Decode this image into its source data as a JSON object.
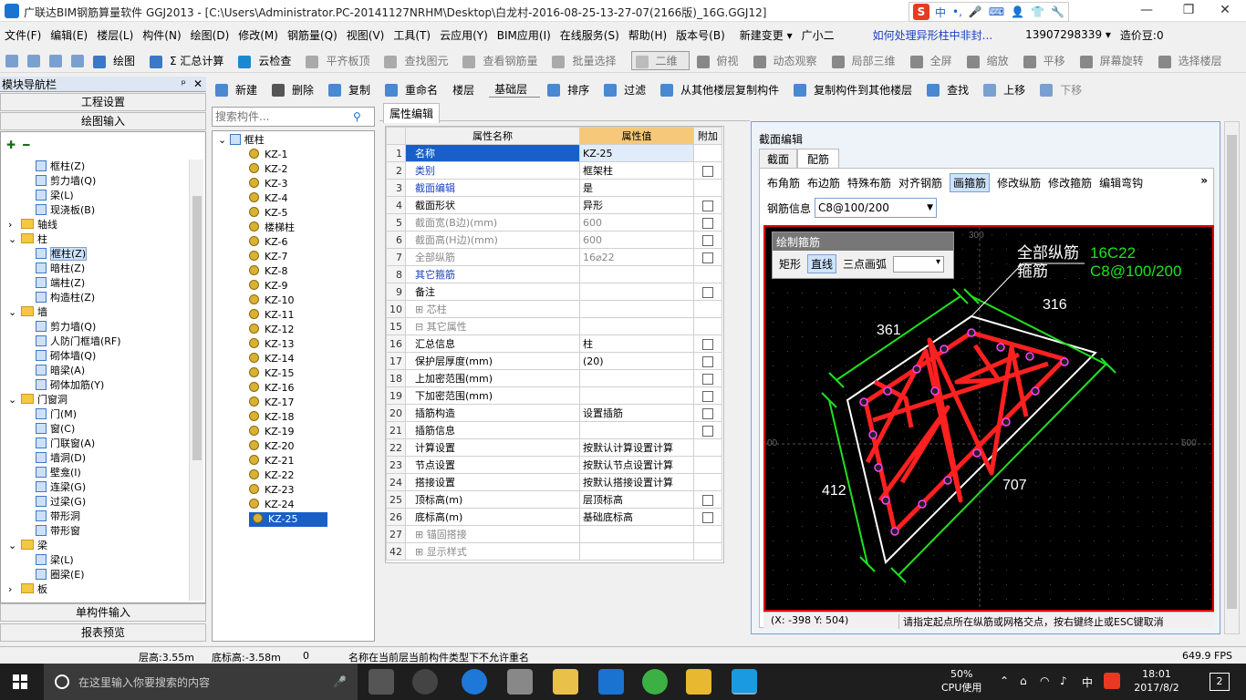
{
  "window": {
    "title": "广联达BIM钢筋算量软件 GGJ2013 - [C:\\Users\\Administrator.PC-20141127NRHM\\Desktop\\白龙村-2016-08-25-13-27-07(2166版)_16G.GGJ12]",
    "min": "—",
    "max": "❐",
    "close": "✕"
  },
  "ime": {
    "logo": "S",
    "items": [
      "中",
      "•,",
      "🎤",
      "⌨",
      "👤",
      "👕",
      "🔧"
    ]
  },
  "menu": [
    "文件(F)",
    "编辑(E)",
    "楼层(L)",
    "构件(N)",
    "绘图(D)",
    "修改(M)",
    "钢筋量(Q)",
    "视图(V)",
    "工具(T)",
    "云应用(Y)",
    "BIM应用(I)",
    "在线服务(S)",
    "帮助(H)",
    "版本号(B)",
    "新建变更 ▾",
    "广小二",
    "如何处理异形柱中非封...",
    "13907298339 ▾",
    "造价豆:0"
  ],
  "toolbar1": [
    "绘图",
    "Σ 汇总计算",
    "云检查",
    "平齐板顶",
    "查找图元",
    "查看钢筋量",
    "批量选择",
    "二维",
    "俯视",
    "动态观察",
    "局部三维",
    "全屏",
    "缩放",
    "平移",
    "屏幕旋转",
    "选择楼层"
  ],
  "toolbar2": [
    "新建",
    "删除",
    "复制",
    "重命名",
    "楼层",
    "基础层",
    "排序",
    "过滤",
    "从其他楼层复制构件",
    "复制构件到其他楼层",
    "查找",
    "上移",
    "下移"
  ],
  "nav": {
    "header": "模块导航栏",
    "pin": "ᵖ",
    "close": "✕",
    "btn_project": "工程设置",
    "btn_draw": "绘图输入",
    "btn_single": "单构件输入",
    "btn_report": "报表预览",
    "items": [
      {
        "indent": 2,
        "type": "icon",
        "label": "框柱(Z)"
      },
      {
        "indent": 2,
        "type": "icon",
        "label": "剪力墙(Q)"
      },
      {
        "indent": 2,
        "type": "icon",
        "label": "梁(L)"
      },
      {
        "indent": 2,
        "type": "icon",
        "label": "现浇板(B)"
      },
      {
        "indent": 0,
        "type": "folder",
        "exp": "›",
        "label": "轴线"
      },
      {
        "indent": 0,
        "type": "folder",
        "exp": "⌄",
        "label": "柱"
      },
      {
        "indent": 2,
        "type": "icon",
        "label": "框柱(Z)",
        "sel": true
      },
      {
        "indent": 2,
        "type": "icon",
        "label": "暗柱(Z)"
      },
      {
        "indent": 2,
        "type": "icon",
        "label": "端柱(Z)"
      },
      {
        "indent": 2,
        "type": "icon",
        "label": "构造柱(Z)"
      },
      {
        "indent": 0,
        "type": "folder",
        "exp": "⌄",
        "label": "墙"
      },
      {
        "indent": 2,
        "type": "icon",
        "label": "剪力墙(Q)"
      },
      {
        "indent": 2,
        "type": "icon",
        "label": "人防门框墙(RF)"
      },
      {
        "indent": 2,
        "type": "icon",
        "label": "砌体墙(Q)"
      },
      {
        "indent": 2,
        "type": "icon",
        "label": "暗梁(A)"
      },
      {
        "indent": 2,
        "type": "icon",
        "label": "砌体加筋(Y)"
      },
      {
        "indent": 0,
        "type": "folder",
        "exp": "⌄",
        "label": "门窗洞"
      },
      {
        "indent": 2,
        "type": "icon",
        "label": "门(M)"
      },
      {
        "indent": 2,
        "type": "icon",
        "label": "窗(C)"
      },
      {
        "indent": 2,
        "type": "icon",
        "label": "门联窗(A)"
      },
      {
        "indent": 2,
        "type": "icon",
        "label": "墙洞(D)"
      },
      {
        "indent": 2,
        "type": "icon",
        "label": "壁龛(I)"
      },
      {
        "indent": 2,
        "type": "icon",
        "label": "连梁(G)"
      },
      {
        "indent": 2,
        "type": "icon",
        "label": "过梁(G)"
      },
      {
        "indent": 2,
        "type": "icon",
        "label": "带形洞"
      },
      {
        "indent": 2,
        "type": "icon",
        "label": "带形窗"
      },
      {
        "indent": 0,
        "type": "folder",
        "exp": "⌄",
        "label": "梁"
      },
      {
        "indent": 2,
        "type": "icon",
        "label": "梁(L)"
      },
      {
        "indent": 2,
        "type": "icon",
        "label": "圈梁(E)"
      },
      {
        "indent": 0,
        "type": "folder",
        "exp": "›",
        "label": "板"
      }
    ]
  },
  "comp": {
    "search_placeholder": "搜索构件...",
    "root": "框柱",
    "items": [
      "KZ-1",
      "KZ-2",
      "KZ-3",
      "KZ-4",
      "KZ-5",
      "楼梯柱",
      "KZ-6",
      "KZ-7",
      "KZ-8",
      "KZ-9",
      "KZ-10",
      "KZ-11",
      "KZ-12",
      "KZ-13",
      "KZ-14",
      "KZ-15",
      "KZ-16",
      "KZ-17",
      "KZ-18",
      "KZ-19",
      "KZ-20",
      "KZ-21",
      "KZ-22",
      "KZ-23",
      "KZ-24",
      "KZ-25"
    ]
  },
  "props": {
    "tab": "属性编辑",
    "h_name": "属性名称",
    "h_value": "属性值",
    "h_extra": "附加",
    "rows": [
      {
        "n": "1",
        "k": "名称",
        "v": "KZ-25",
        "cb": false,
        "c": "b",
        "sel": true
      },
      {
        "n": "2",
        "k": "类别",
        "v": "框架柱",
        "cb": true,
        "c": "b"
      },
      {
        "n": "3",
        "k": "截面编辑",
        "v": "是",
        "cb": false,
        "c": "b"
      },
      {
        "n": "4",
        "k": "截面形状",
        "v": "异形",
        "cb": true,
        "c": ""
      },
      {
        "n": "5",
        "k": "截面宽(B边)(mm)",
        "v": "600",
        "cb": true,
        "c": "g"
      },
      {
        "n": "6",
        "k": "截面高(H边)(mm)",
        "v": "600",
        "cb": true,
        "c": "g"
      },
      {
        "n": "7",
        "k": "全部纵筋",
        "v": "16⌀22",
        "cb": true,
        "c": "g"
      },
      {
        "n": "8",
        "k": "其它箍筋",
        "v": "",
        "cb": false,
        "c": "b"
      },
      {
        "n": "9",
        "k": "备注",
        "v": "",
        "cb": true,
        "c": ""
      },
      {
        "n": "10",
        "k": "⊞ 芯柱",
        "v": "",
        "cb": false,
        "c": "g"
      },
      {
        "n": "15",
        "k": "⊟ 其它属性",
        "v": "",
        "cb": false,
        "c": "g"
      },
      {
        "n": "16",
        "k": "    汇总信息",
        "v": "柱",
        "cb": true,
        "c": ""
      },
      {
        "n": "17",
        "k": "    保护层厚度(mm)",
        "v": "(20)",
        "cb": true,
        "c": ""
      },
      {
        "n": "18",
        "k": "    上加密范围(mm)",
        "v": "",
        "cb": true,
        "c": ""
      },
      {
        "n": "19",
        "k": "    下加密范围(mm)",
        "v": "",
        "cb": true,
        "c": ""
      },
      {
        "n": "20",
        "k": "    插筋构造",
        "v": "设置插筋",
        "cb": true,
        "c": ""
      },
      {
        "n": "21",
        "k": "    插筋信息",
        "v": "",
        "cb": true,
        "c": ""
      },
      {
        "n": "22",
        "k": "    计算设置",
        "v": "按默认计算设置计算",
        "cb": false,
        "c": ""
      },
      {
        "n": "23",
        "k": "    节点设置",
        "v": "按默认节点设置计算",
        "cb": false,
        "c": ""
      },
      {
        "n": "24",
        "k": "    搭接设置",
        "v": "按默认搭接设置计算",
        "cb": false,
        "c": ""
      },
      {
        "n": "25",
        "k": "    顶标高(m)",
        "v": "层顶标高",
        "cb": true,
        "c": ""
      },
      {
        "n": "26",
        "k": "    底标高(m)",
        "v": "基础底标高",
        "cb": true,
        "c": ""
      },
      {
        "n": "27",
        "k": "⊞ 锚固搭接",
        "v": "",
        "cb": false,
        "c": "g"
      },
      {
        "n": "42",
        "k": "⊞ 显示样式",
        "v": "",
        "cb": false,
        "c": "g"
      }
    ]
  },
  "section": {
    "title": "截面编辑",
    "tab1": "截面",
    "tab2": "配筋",
    "tools": [
      "布角筋",
      "布边筋",
      "特殊布筋",
      "对齐钢筋",
      "画箍筋",
      "修改纵筋",
      "修改箍筋",
      "编辑弯钩"
    ],
    "info_label": "钢筋信息",
    "info_value": "C8@100/200",
    "stirrup_title": "绘制箍筋",
    "stirrup_btns": [
      "矩形",
      "直线",
      "三点画弧"
    ],
    "label_long": "全部纵筋",
    "label_stir": "箍筋",
    "val_long": "16C22",
    "val_stir": "C8@100/200",
    "dims": [
      "361",
      "316",
      "412",
      "707"
    ],
    "grid_lbl": [
      "300",
      "00",
      "500"
    ],
    "coords": "(X: -398 Y: 504)",
    "hint": "请指定起点所在纵筋或网格交点，按右键终止或ESC键取消"
  },
  "status": {
    "floor_h": "层高:3.55m",
    "base_h": "底标高:-3.58m",
    "zero": "0",
    "msg": "名称在当前层当前构件类型下不允许重名",
    "fps": "649.9 FPS"
  },
  "taskbar": {
    "search": "在这里输入你要搜索的内容",
    "cpu": "50%",
    "cpu_lbl": "CPU使用",
    "time": "18:01",
    "date": "2017/8/2",
    "lang": "中",
    "notif": "2"
  },
  "colors": {
    "accent": "#1a73d0",
    "rebar": "#ff0000",
    "dim": "#00e000",
    "canvas": "#000000"
  }
}
